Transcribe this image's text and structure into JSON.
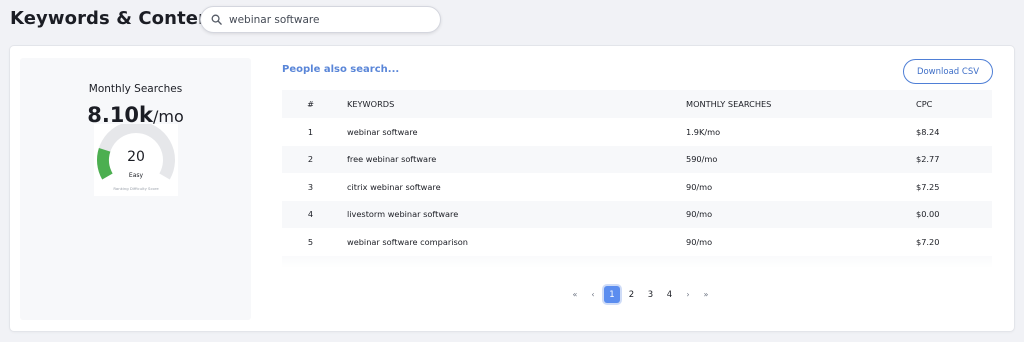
{
  "header": {
    "title": "Keywords & Content",
    "search": {
      "value": "webinar software",
      "placeholder": ""
    }
  },
  "stats": {
    "monthly_searches_label": "Monthly Searches",
    "monthly_searches_value": "8.10k",
    "monthly_searches_unit": "/mo",
    "difficulty": {
      "score": "20",
      "score_fraction": 0.2,
      "rating": "Easy",
      "caption": "Ranking Difficulty Score",
      "colors": {
        "track": "#e6e7ea",
        "fill": "#4caf50"
      }
    }
  },
  "related": {
    "link_label": "People also search...",
    "download_label": "Download CSV",
    "columns": [
      "#",
      "KEYWORDS",
      "MONTHLY SEARCHES",
      "CPC"
    ],
    "rows": [
      {
        "num": "1",
        "keyword": "webinar software",
        "monthly": "1.9K/mo",
        "cpc": "$8.24"
      },
      {
        "num": "2",
        "keyword": "free webinar software",
        "monthly": "590/mo",
        "cpc": "$2.77"
      },
      {
        "num": "3",
        "keyword": "citrix webinar software",
        "monthly": "90/mo",
        "cpc": "$7.25"
      },
      {
        "num": "4",
        "keyword": "livestorm webinar software",
        "monthly": "90/mo",
        "cpc": "$0.00"
      },
      {
        "num": "5",
        "keyword": "webinar software comparison",
        "monthly": "90/mo",
        "cpc": "$7.20"
      }
    ]
  },
  "pagination": {
    "first": "«",
    "prev": "‹",
    "pages": [
      "1",
      "2",
      "3",
      "4"
    ],
    "active_page": "1",
    "next": "›",
    "last": "»"
  },
  "colors": {
    "accent": "#5b8def",
    "link": "#5a86d8",
    "background": "#f1f2f6"
  }
}
